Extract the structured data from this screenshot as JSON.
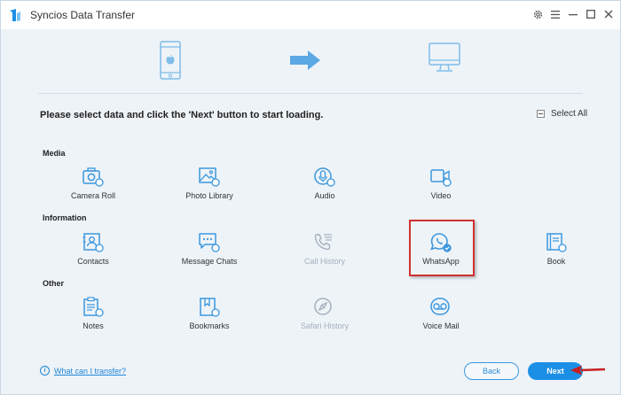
{
  "window": {
    "title": "Syncios Data Transfer"
  },
  "instruction": "Please select data and click the 'Next' button to start loading.",
  "select_all_label": "Select All",
  "sections": [
    {
      "label": "Media",
      "items": [
        {
          "label": "Camera Roll",
          "icon": "camera-roll-icon",
          "enabled": true
        },
        {
          "label": "Photo Library",
          "icon": "photo-library-icon",
          "enabled": true
        },
        {
          "label": "Audio",
          "icon": "audio-icon",
          "enabled": true
        },
        {
          "label": "Video",
          "icon": "video-icon",
          "enabled": true
        }
      ]
    },
    {
      "label": "Information",
      "items": [
        {
          "label": "Contacts",
          "icon": "contacts-icon",
          "enabled": true
        },
        {
          "label": "Message Chats",
          "icon": "message-chats-icon",
          "enabled": true
        },
        {
          "label": "Call History",
          "icon": "call-history-icon",
          "enabled": false
        },
        {
          "label": "WhatsApp",
          "icon": "whatsapp-icon",
          "enabled": true,
          "selected": true
        },
        {
          "label": "Book",
          "icon": "book-icon",
          "enabled": true
        }
      ]
    },
    {
      "label": "Other",
      "items": [
        {
          "label": "Notes",
          "icon": "notes-icon",
          "enabled": true
        },
        {
          "label": "Bookmarks",
          "icon": "bookmarks-icon",
          "enabled": true
        },
        {
          "label": "Safari History",
          "icon": "safari-history-icon",
          "enabled": false
        },
        {
          "label": "Voice Mail",
          "icon": "voice-mail-icon",
          "enabled": true
        }
      ]
    }
  ],
  "footer": {
    "help_link": "What can I transfer?",
    "back_label": "Back",
    "next_label": "Next"
  },
  "colors": {
    "accent": "#1b8fe6",
    "icon": "#3a97de",
    "disabled": "#a4b0bc",
    "highlight": "#d03030",
    "background": "#eef3f8"
  }
}
